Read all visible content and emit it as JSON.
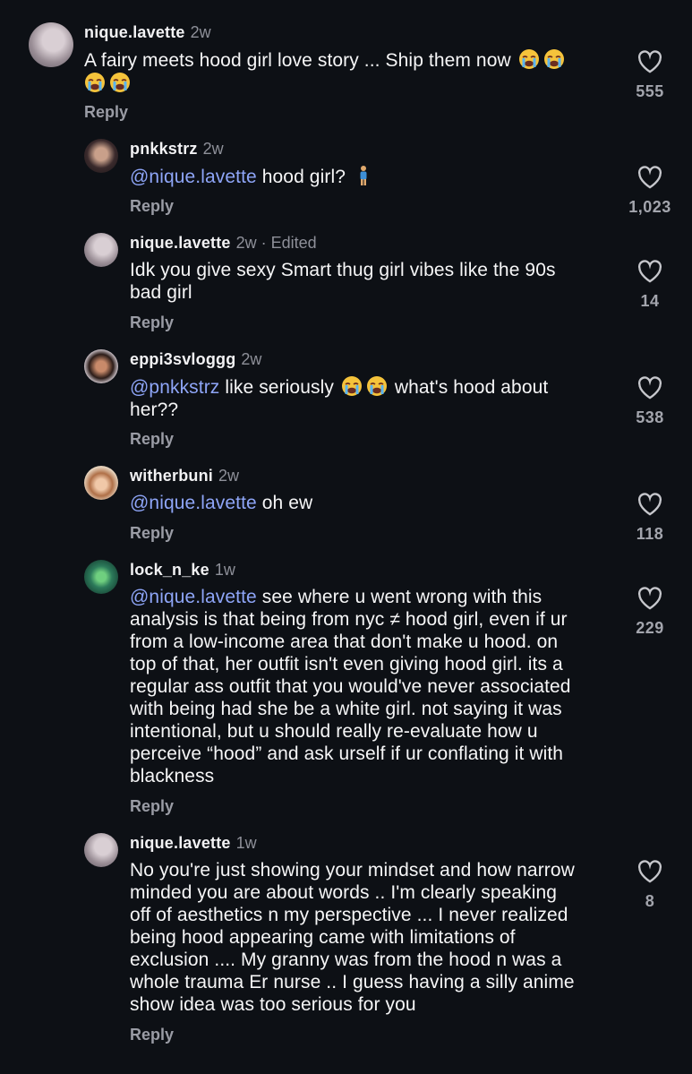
{
  "comments": [
    {
      "username": "nique.lavette",
      "meta": "2w",
      "text": "A fairy meets hood girl love story ... Ship them now",
      "reply": "Reply",
      "likes": "555"
    },
    {
      "username": "pnkkstrz",
      "meta": "2w",
      "mention": "@nique.lavette",
      "text": "hood girl?",
      "reply": "Reply",
      "likes": "1,023"
    },
    {
      "username": "nique.lavette",
      "meta": "2w · Edited",
      "text_line1": "Idk you give sexy Smart thug girl vibes like the 90s",
      "text_line2": "bad girl",
      "reply": "Reply",
      "likes": "14"
    },
    {
      "username": "eppi3svloggg",
      "meta": "2w",
      "mention": "@pnkkstrz",
      "text_a": "like seriously",
      "text_b": "what's hood about",
      "text_line2": "her??",
      "reply": "Reply",
      "likes": "538"
    },
    {
      "username": "witherbuni",
      "meta": "2w",
      "mention": "@nique.lavette",
      "text": "oh ew",
      "reply": "Reply",
      "likes": "118"
    },
    {
      "username": "lock_n_ke",
      "meta": "1w",
      "mention": "@nique.lavette",
      "lines": [
        "see where u went wrong with this",
        "analysis is that being from nyc ≠ hood girl, even if ur",
        "from a low-income area that don't make u hood. on",
        "top of that, her outfit isn't even giving hood girl. its a",
        "regular ass outfit that you would've never associated",
        "with being had she be a white girl. not saying it was",
        "intentional, but u should really re-evaluate how u",
        "perceive “hood” and ask urself if ur conflating it with",
        "blackness"
      ],
      "reply": "Reply",
      "likes": "229"
    },
    {
      "username": "nique.lavette",
      "meta": "1w",
      "lines": [
        "No you're just showing your mindset and how narrow",
        "minded you are about words .. I'm clearly speaking",
        "off of aesthetics n my perspective ... I never realized",
        "being hood appearing came with limitations of",
        "exclusion .... My granny was from the hood n was a",
        "whole trauma Er nurse .. I guess having a silly anime",
        "show idea was too serious for you"
      ],
      "reply": "Reply",
      "likes": "8"
    }
  ],
  "icons": {
    "like": "heart-outline-icon",
    "reaction": "loudly-crying-face-emoji",
    "extra": "person-standing-emoji"
  },
  "colors": {
    "background": "#0d1015",
    "mention": "#8ea5f7",
    "muted": "#8e9099"
  }
}
